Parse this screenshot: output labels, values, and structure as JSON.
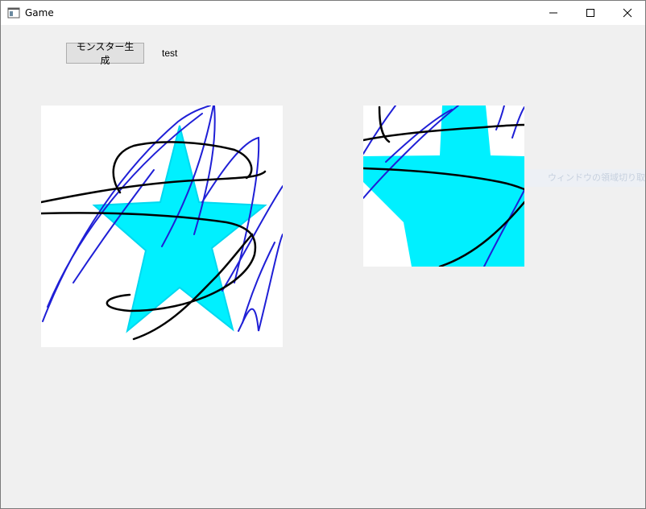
{
  "window": {
    "title": "Game",
    "minimize_icon": "minimize-icon",
    "maximize_icon": "maximize-icon",
    "close_icon": "close-icon"
  },
  "toolbar": {
    "spawn_label": "モンスター生成",
    "status_text": "test"
  },
  "canvases": {
    "main": {
      "background": "#ffffff",
      "star_color": "#00f0ff",
      "scribble_blue": "#1f1fd6",
      "scribble_black": "#000000"
    },
    "crop": {
      "background": "#ffffff"
    }
  },
  "tooltip": {
    "text": "ウィンドウの領域切り取り"
  }
}
